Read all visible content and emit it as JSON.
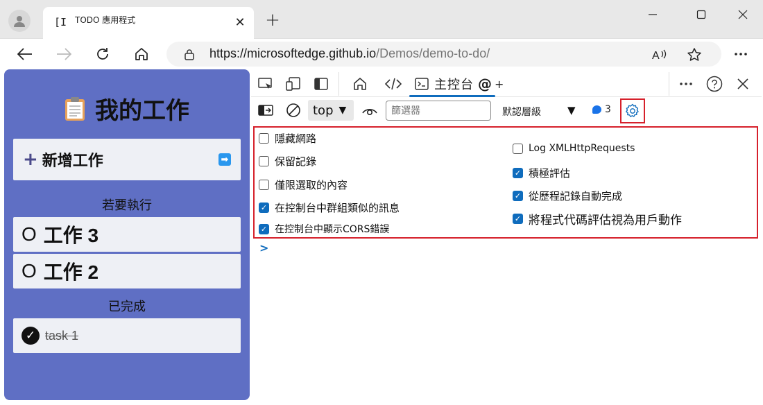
{
  "browser": {
    "tab": {
      "favicon": "[I",
      "title": "TODO 應用程式",
      "close_icon": "close-icon"
    },
    "new_tab_label": "+",
    "address": {
      "url_base": "https://microsoftedge.github.io",
      "url_path": "/Demos/demo-to-do/"
    }
  },
  "webapp": {
    "title": "我的工作",
    "add_task_label": "新增工作",
    "todo_heading": "若要執行",
    "todo_items": [
      {
        "marker": "O",
        "name": "工作 3"
      },
      {
        "marker": "O",
        "name": "工作 2"
      }
    ],
    "done_heading": "已完成",
    "done_items": [
      {
        "name": "task 1"
      }
    ]
  },
  "devtools": {
    "console_tab": {
      "label": "主控台",
      "extra": "@",
      "add": "+"
    },
    "toolbar": {
      "context": "top",
      "filter_placeholder": "篩選器",
      "levels": "默認層級",
      "issues_count": "3"
    },
    "settings": {
      "left": [
        {
          "label": "隱藏網路",
          "checked": false
        },
        {
          "label": "保留記錄",
          "checked": false
        },
        {
          "label": "僅限選取的內容",
          "checked": false
        },
        {
          "label": "在控制台中群組類似的訊息",
          "checked": true
        },
        {
          "label": "在控制台中顯示CORS錯誤",
          "checked": true
        }
      ],
      "right": [
        {
          "label": "Log XMLHttpRequests",
          "checked": false
        },
        {
          "label": "積極評估",
          "checked": true
        },
        {
          "label": "從歷程記錄自動完成",
          "checked": true
        },
        {
          "label": "將程式代碼評估視為用戶動作",
          "checked": true
        }
      ]
    },
    "prompt": ">"
  },
  "colors": {
    "accent": "#0f6cbd",
    "highlight": "#d6202b",
    "app_bg": "#5f6fc4"
  }
}
